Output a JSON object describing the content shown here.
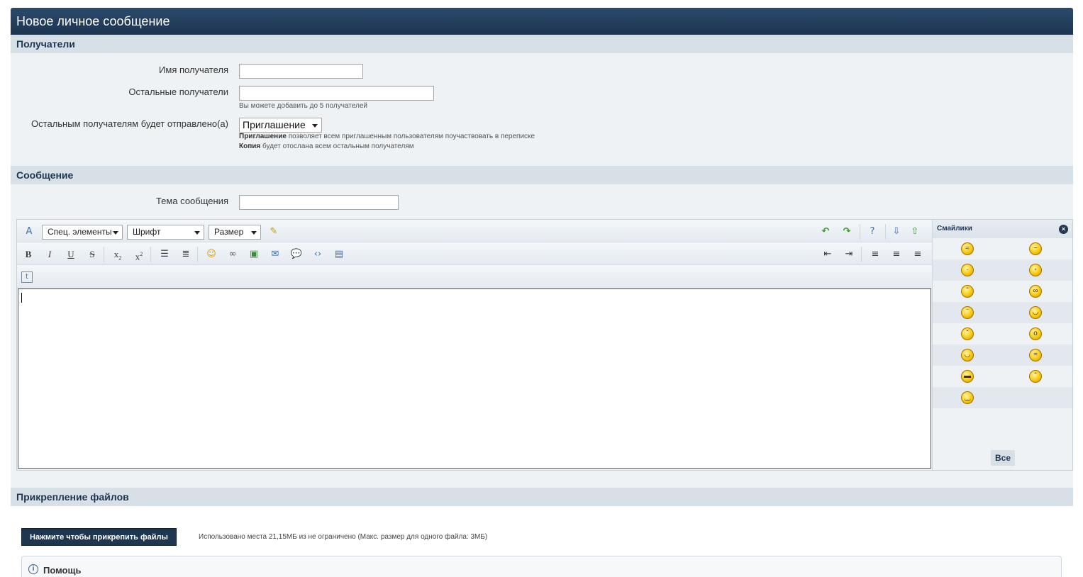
{
  "header": {
    "title": "Новое личное сообщение"
  },
  "recipients": {
    "section_title": "Получатели",
    "recipient_label": "Имя получателя",
    "recipient_value": "",
    "others_label": "Остальные получатели",
    "others_value": "",
    "others_hint_prefix": "Вы можете добавить до ",
    "others_hint_count": "5",
    "others_hint_suffix": " получателей",
    "send_mode_label": "Остальным получателям будет отправлено(а)",
    "send_mode_selected": "Приглашение",
    "hint_invite_bold": "Приглашение",
    "hint_invite_text": " позволяет всем приглашенным пользователям поучаствовать в переписке",
    "hint_copy_bold": "Копия",
    "hint_copy_text": " будет отослана всем остальным получателям"
  },
  "message": {
    "section_title": "Сообщение",
    "subject_label": "Тема сообщения",
    "subject_value": "",
    "toolbar": {
      "special_select": "Спец. элементы",
      "font_select": "Шрифт",
      "size_select": "Размер",
      "bold": "B",
      "italic": "I",
      "underline": "U",
      "strike": "S"
    },
    "body_value": ""
  },
  "smilies": {
    "title": "Смайлики",
    "all_label": "Все",
    "icons": [
      "smiley-dizzy-icon",
      "smiley-sleepy-icon",
      "smiley-neutral-icon",
      "smiley-crazy-icon",
      "smiley-angry-icon",
      "smiley-glasses-icon",
      "smiley-confused-icon",
      "smiley-laugh-icon",
      "smiley-wink-icon",
      "smiley-shocked-icon",
      "smiley-tongue-icon",
      "smiley-grin-icon",
      "smiley-cool-icon",
      "smiley-worried-icon",
      "smiley-smile-icon"
    ]
  },
  "attachments": {
    "section_title": "Прикрепление файлов",
    "button_label": "Нажмите чтобы прикрепить файлы",
    "usage_info": "Использовано места 21,15МБ из не ограничено (Макс. размер для одного файла: 3МБ)",
    "help_label": "Помощь"
  },
  "colors": {
    "header_bg": "#1d3450",
    "section_bg": "#d7dfe7",
    "body_bg": "#eef2f5",
    "accent": "#1f3650"
  }
}
